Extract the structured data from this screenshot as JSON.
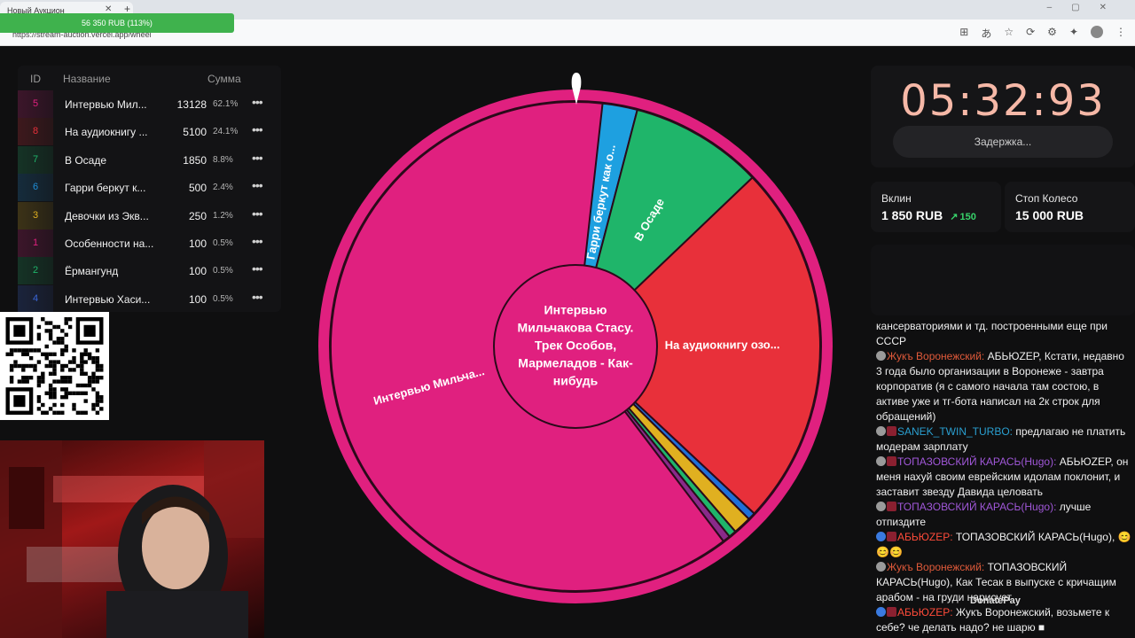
{
  "browser": {
    "tab_title": "Новый Аукцион",
    "url": "https://stream-auction.vercel.app/wheel"
  },
  "donation_alert": {
    "text": "56 350 RUB (113%)",
    "fill_fraction": 1.0
  },
  "lots": {
    "headers": {
      "id": "ID",
      "name": "Название",
      "sum": "Сумма"
    },
    "rows": [
      {
        "id": "5",
        "name": "Интервью Мил...",
        "amount": "13128",
        "pct": "62.1%",
        "color": "#e0207f"
      },
      {
        "id": "8",
        "name": "На аудиокнигу ...",
        "amount": "5100",
        "pct": "24.1%",
        "color": "#e8303a"
      },
      {
        "id": "7",
        "name": "В Осаде",
        "amount": "1850",
        "pct": "8.8%",
        "color": "#1fb56a"
      },
      {
        "id": "6",
        "name": "Гарри беркут к...",
        "amount": "500",
        "pct": "2.4%",
        "color": "#1f8fd8"
      },
      {
        "id": "3",
        "name": "Девочки из Экв...",
        "amount": "250",
        "pct": "1.2%",
        "color": "#e0b020"
      },
      {
        "id": "1",
        "name": "Особенности на...",
        "amount": "100",
        "pct": "0.5%",
        "color": "#e0207f"
      },
      {
        "id": "2",
        "name": "Ёрмангунд",
        "amount": "100",
        "pct": "0.5%",
        "color": "#1fb56a"
      },
      {
        "id": "4",
        "name": "Интервью Хаси...",
        "amount": "100",
        "pct": "0.5%",
        "color": "#3a66d8"
      }
    ],
    "more_icon": "more-horizontal-icon"
  },
  "wheel": {
    "center_text": "Интервью Мильчакова Стасу. Трек Особов, Мармеладов - Как-нибудь",
    "center_lines": [
      "Интервью",
      "Мильчакова Стасу.",
      "Трек Особов,",
      "Мармеладов - Как-",
      "нибудь"
    ],
    "rim_color": "#e0207f",
    "slices": [
      {
        "label": "Гарри беркут как о...",
        "color": "#1ea0e0",
        "share": 0.024
      },
      {
        "label": "В Осаде",
        "color": "#1fb56a",
        "share": 0.088
      },
      {
        "label": "На аудиокнигу озо...",
        "color": "#e8303a",
        "share": 0.241
      },
      {
        "label": "",
        "color": "#1f6fd8",
        "share": 0.005
      },
      {
        "label": "",
        "color": "#e0b020",
        "share": 0.012
      },
      {
        "label": "",
        "color": "#1fb56a",
        "share": 0.005
      },
      {
        "label": "",
        "color": "#8a2a8a",
        "share": 0.005
      },
      {
        "label": "Интервью Мильча...",
        "color": "#e0207f",
        "share": 0.621
      }
    ]
  },
  "timer": {
    "value": "05:32:93",
    "delay_label": "Задержка..."
  },
  "stats": {
    "vklin_label": "Вклин",
    "vklin_value": "1 850 RUB",
    "vklin_delta": "150",
    "stop_label": "Стоп Колесо",
    "stop_value": "15 000 RUB"
  },
  "chat": {
    "messages": [
      {
        "user": "",
        "text": "кансерваториями и тд. построенными еще при СССР",
        "badges": []
      },
      {
        "user": "Жукъ Воронежский:",
        "text": "АБЬЮZEP, Кстати, недавно 3 года было организации в Воронеже - завтра корпоратив (я с самого начала там состою, в активе уже и тг-бота написал на 2к строк для обращений)",
        "badges": [
          "round"
        ],
        "user_class": "u-red"
      },
      {
        "user": "SANEK_TWIN_TURBO:",
        "text": "предлагаю не платить модерам зарплату",
        "badges": [
          "round",
          "sq"
        ],
        "user_class": "u-teal"
      },
      {
        "user": "ТОПАЗОВСКИЙ КАРАСЬ(Hugo):",
        "text": "АБЬЮZEP, он меня нахуй своим еврейским идолам поклонит, и заставит звезду Давида целовать",
        "badges": [
          "round",
          "sq"
        ],
        "user_class": "u-purple"
      },
      {
        "user": "ТОПАЗОВСКИЙ КАРАСЬ(Hugo):",
        "text": "лучше отпиздите",
        "badges": [
          "round",
          "sq"
        ],
        "user_class": "u-purple"
      },
      {
        "user": "АБЬЮZEP:",
        "text": "ТОПАЗОВСКИЙ КАРАСЬ(Hugo), 😊😊😊",
        "badges": [
          "blue",
          "sq"
        ],
        "user_class": "u-orange"
      },
      {
        "user": "Жукъ Воронежский:",
        "text": "ТОПАЗОВСКИЙ КАРАСЬ(Hugo), Как Тесак в выпуске с кричащим арабом - на груди нарисует",
        "badges": [
          "round"
        ],
        "user_class": "u-red"
      },
      {
        "user": "АБЬЮZEP:",
        "text": "Жукъ Воронежский, возьмете к себе? че делать надо? не шарю ■",
        "badges": [
          "blue",
          "sq"
        ],
        "user_class": "u-orange"
      }
    ],
    "overlay": "DonatePay"
  }
}
